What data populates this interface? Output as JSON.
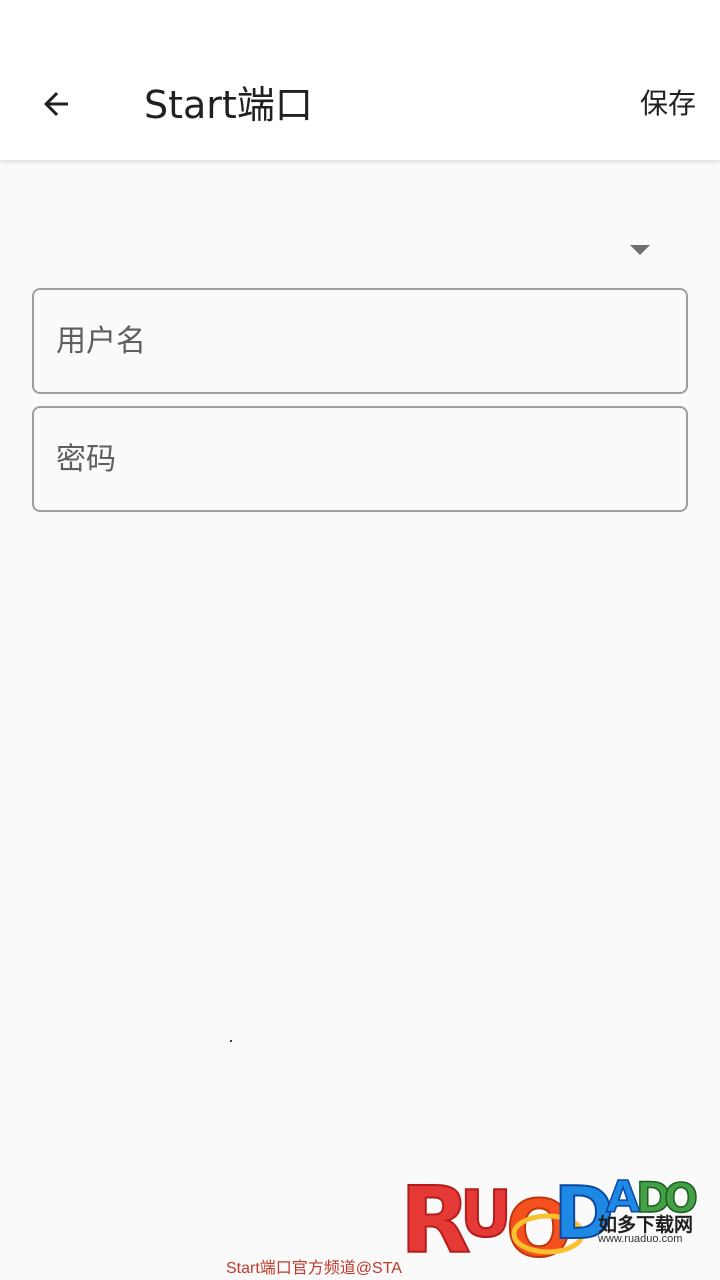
{
  "app_bar": {
    "title": "Start端口",
    "back_icon": "arrow-left-icon",
    "save_label": "保存"
  },
  "form": {
    "dropdown": {
      "selected": "",
      "caret_icon": "caret-down-icon"
    },
    "username": {
      "placeholder": "用户名",
      "value": ""
    },
    "password": {
      "placeholder": "密码",
      "value": ""
    }
  },
  "watermark": {
    "logo_text": "RUADADO",
    "subtitle": "如多下载网",
    "url": "www.ruaduo.com",
    "caption": "Start端口官方频道@STA"
  },
  "colors": {
    "background": "#fafafa",
    "app_bar": "#ffffff",
    "field_border": "#9e9e9e",
    "caption": "#c0392b"
  }
}
